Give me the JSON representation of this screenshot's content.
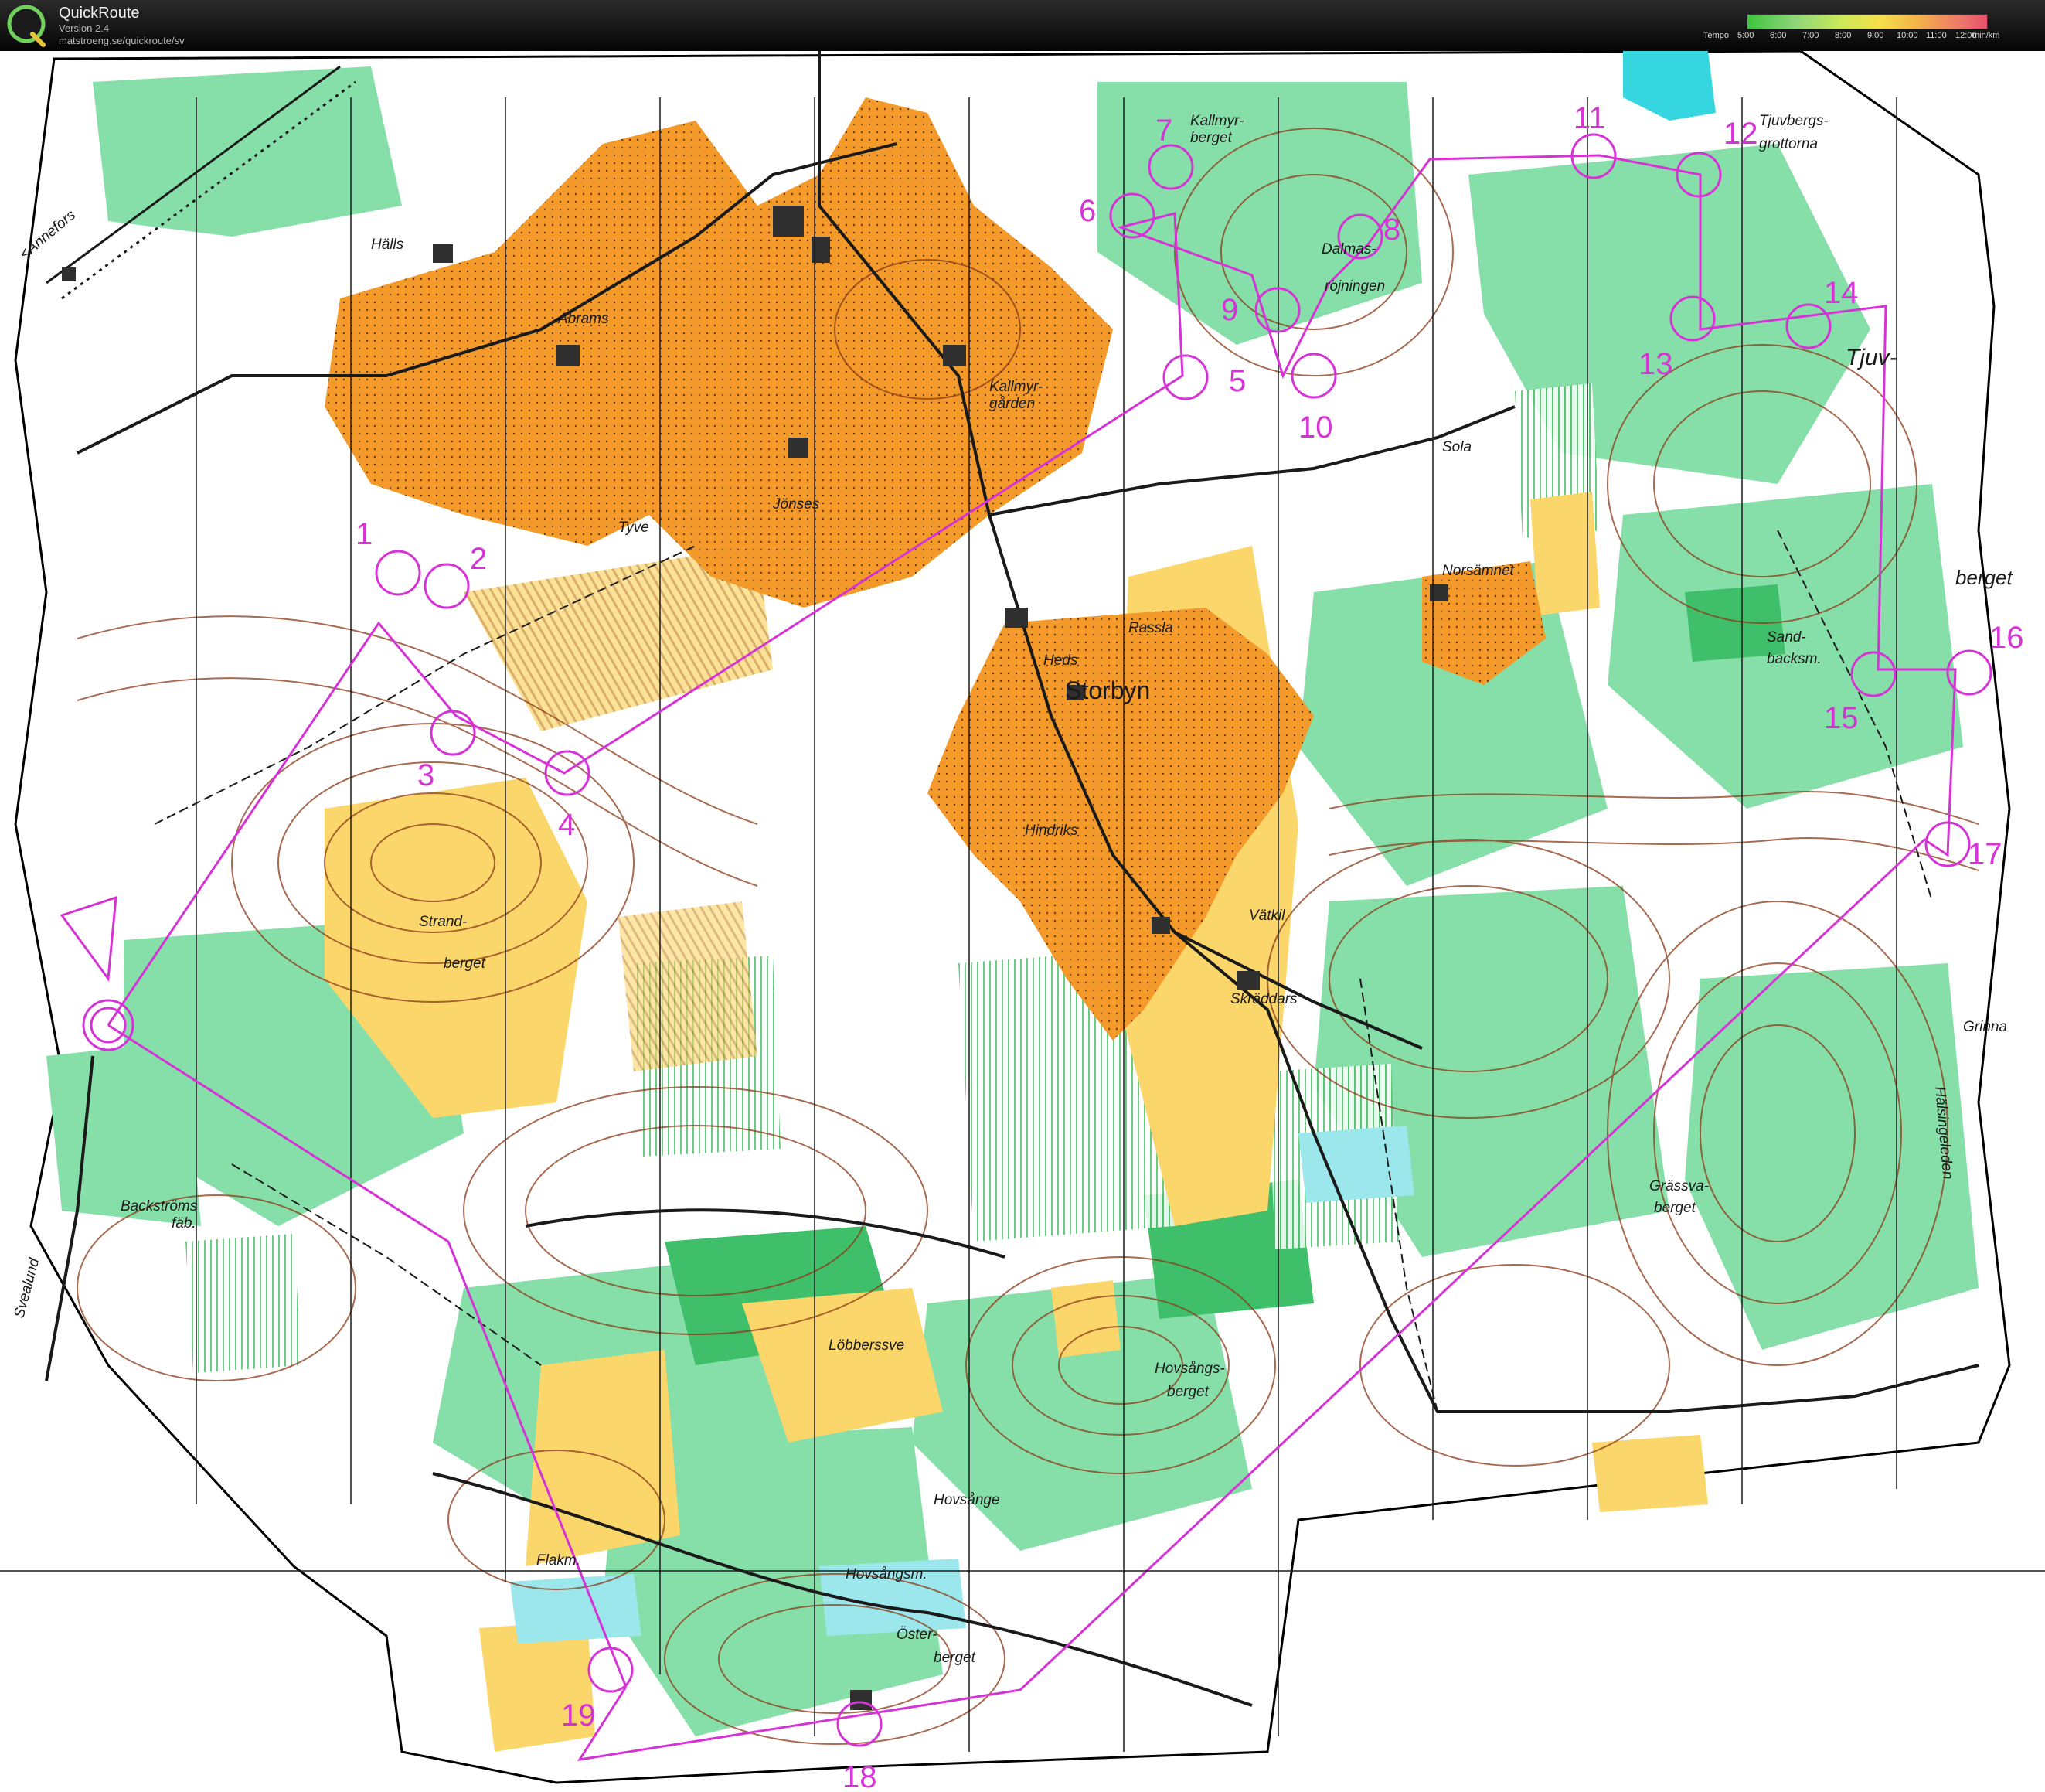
{
  "app": {
    "name": "QuickRoute",
    "version": "Version 2.4",
    "url": "matstroeng.se/quickroute/sv"
  },
  "tempo_legend": {
    "label": "Tempo",
    "ticks": [
      "5:00",
      "6:00",
      "7:00",
      "8:00",
      "9:00",
      "10:00",
      "11:00",
      "12:00"
    ],
    "unit": "min/km",
    "colors": [
      "#3cc43c",
      "#8fd67a",
      "#c8e85a",
      "#f4e04a",
      "#f3b04a",
      "#ee7a6a",
      "#e6506a"
    ]
  },
  "map": {
    "colors": {
      "open_land": "#f39a2a",
      "rough_open": "#fbd66a",
      "forest_green": "#86dfa8",
      "dense_green": "#3fbf6a",
      "water": "#35d6e0",
      "contour": "#8a3a18",
      "course": "#d633d6",
      "building": "#2f2f2f"
    },
    "place_names": [
      "<Annefors",
      "Hälls",
      "Abrams",
      "Jönses",
      "Tyve",
      "Kallmyr-",
      "berget",
      "Kallmyr-",
      "gården",
      "Dalmas-",
      "röjningen",
      "Tjuvbergs-",
      "grottorna",
      "Tjuv-",
      "berget",
      "Sola",
      "Norsämnet",
      "Rassla",
      "Heds",
      "Storbyn",
      "Hindriks",
      "Vätkil",
      "Skräddars",
      "Strand-",
      "berget",
      "Sand-",
      "backsm.",
      "Grinna",
      "Hälsingeleden",
      "Grässva-",
      "berget",
      "Backströms",
      "fäb.",
      "Svealund",
      "Löbberssve",
      "Hovsångs-",
      "berget",
      "Hovsånge",
      "Hovsångsm.",
      "Flakm.",
      "Öster-",
      "berget"
    ],
    "control_numbers": [
      "1",
      "2",
      "3",
      "4",
      "5",
      "6",
      "7",
      "8",
      "9",
      "10",
      "11",
      "12",
      "13",
      "14",
      "15",
      "16",
      "17",
      "18",
      "19"
    ]
  }
}
